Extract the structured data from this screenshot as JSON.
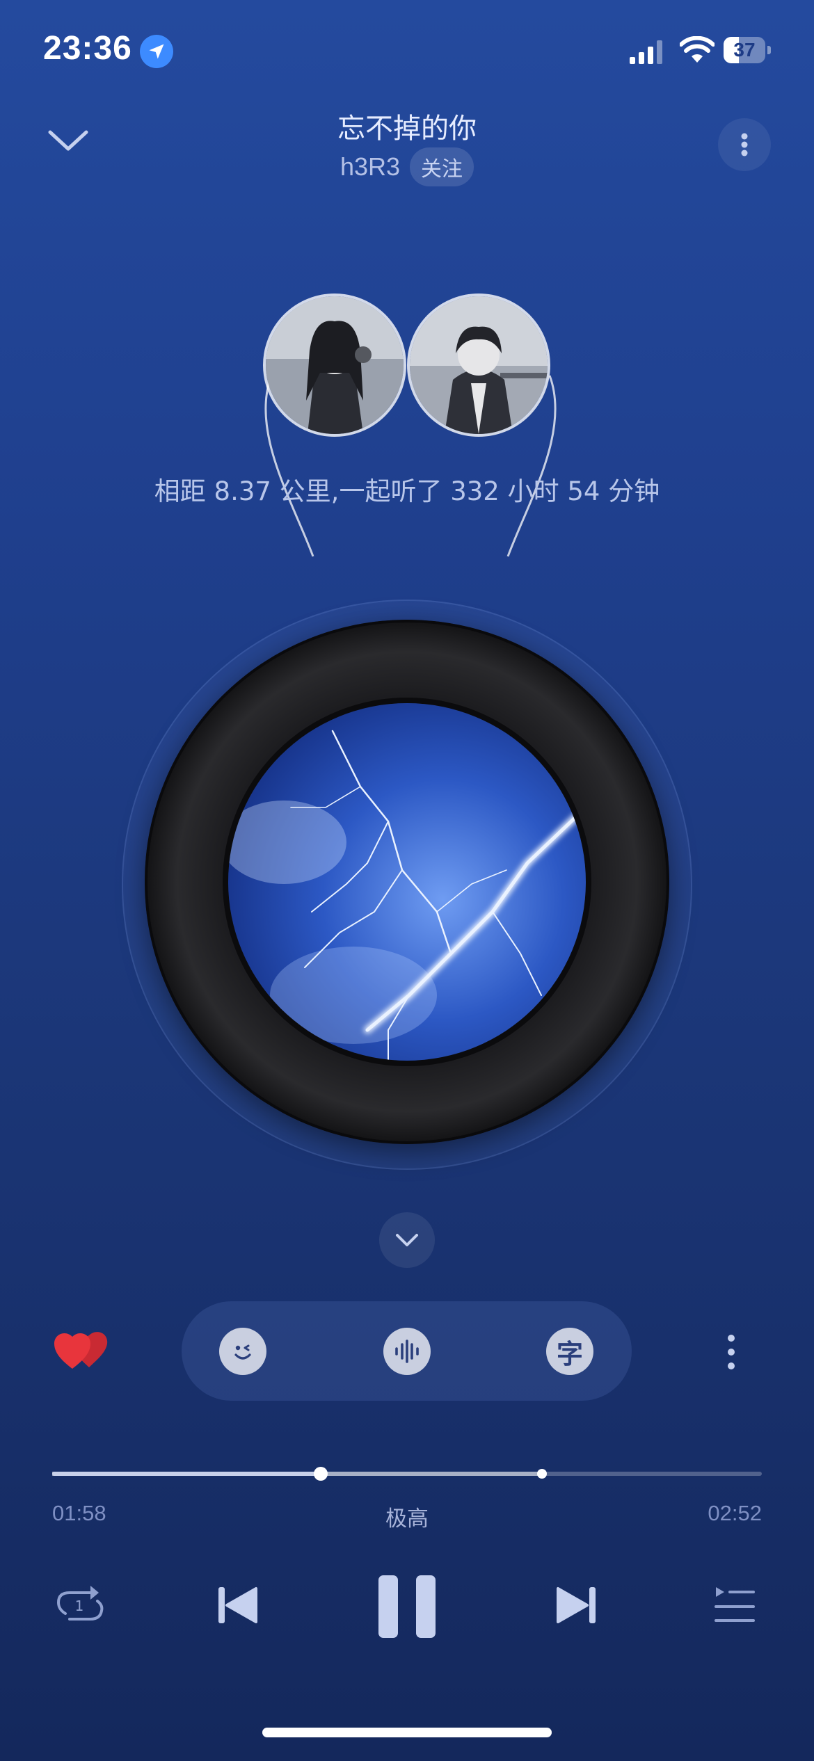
{
  "status_bar": {
    "time": "23:36",
    "battery": "37",
    "battery_level": 0.37
  },
  "header": {
    "song_title": "忘不掉的你",
    "artist": "h3R3",
    "follow_label": "关注"
  },
  "listen_together": {
    "text": "相距 8.37 公里,一起听了 332 小时 54 分钟"
  },
  "player": {
    "current_time": "01:58",
    "duration": "02:52",
    "quality": "极高",
    "played_fraction": 0.378,
    "buffered_fraction": 0.69
  },
  "icons": {
    "collapse": "chevron-down-icon",
    "more": "more-vertical-icon",
    "liked": "double-heart-icon",
    "wink": "wink-face-icon",
    "sound": "sound-wave-icon",
    "lyrics": "lyrics-char-icon",
    "repeat": "repeat-one-icon",
    "prev": "previous-icon",
    "pause": "pause-icon",
    "next": "next-icon",
    "playlist": "playlist-icon"
  },
  "lyrics_glyph": "字",
  "repeat_badge": "1",
  "colors": {
    "accent_like": "#e8353c",
    "background_top": "#244a9e",
    "background_bottom": "#14285c"
  }
}
